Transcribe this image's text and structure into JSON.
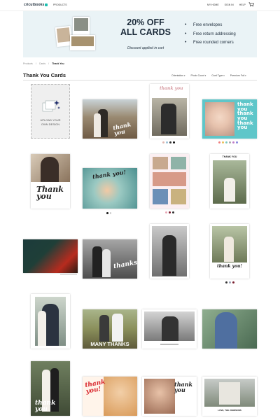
{
  "header": {
    "logo": "cricutbooks",
    "products": "PRODUCTS",
    "links": [
      "MY HOME",
      "SIGN IN",
      "HELP"
    ],
    "cart_icon": "shopping-cart-icon"
  },
  "promo": {
    "title_line1": "20% OFF",
    "title_line2": "ALL CARDS",
    "subtitle": "Discount applied in cart",
    "benefits": [
      "Free envelopes",
      "Free return addressing",
      "Free rounded corners"
    ]
  },
  "breadcrumb": [
    "Products",
    "Cards",
    "Thank You"
  ],
  "page": {
    "title": "Thank You Cards",
    "filters": [
      "Orientation",
      "Photo Count",
      "Card Type",
      "Premium Foil"
    ]
  },
  "upload": {
    "line1": "UPLOAD YOUR",
    "line2": "OWN DESIGN",
    "icon": "upload-sparkle-icon"
  },
  "cards": {
    "c2": {
      "text": "thank you"
    },
    "c3": {
      "text": "thank you",
      "swatches": [
        "#e0b7b0",
        "#9ec3d8",
        "#333333",
        "#111111"
      ]
    },
    "c4": {
      "text": "thank you thank you thank you",
      "swatches": [
        "#f07f7f",
        "#e9c15a",
        "#7fc8c0",
        "#aaaaaa",
        "#c07dc9",
        "#8888dd"
      ]
    },
    "c5": {
      "text": "Thank you"
    },
    "c6": {
      "text": "thank you!"
    },
    "c8": {
      "text": "THANK YOU"
    },
    "c10": {
      "text": "thanks!"
    },
    "c12": {
      "text": "thank you!"
    },
    "c14": {
      "text": "MANY THANKS"
    },
    "c17": {
      "text": "thank you"
    },
    "c18": {
      "text": "thank you!"
    },
    "c20": {
      "text": "thank you"
    },
    "c21": {
      "text": "LOVE, THE JOHNSONS"
    }
  },
  "colors": {
    "accent": "#1dbfb0",
    "banner_bg": "#eaf3f6",
    "teal_card": "#5fc6c9",
    "red_script": "#d8232a"
  }
}
